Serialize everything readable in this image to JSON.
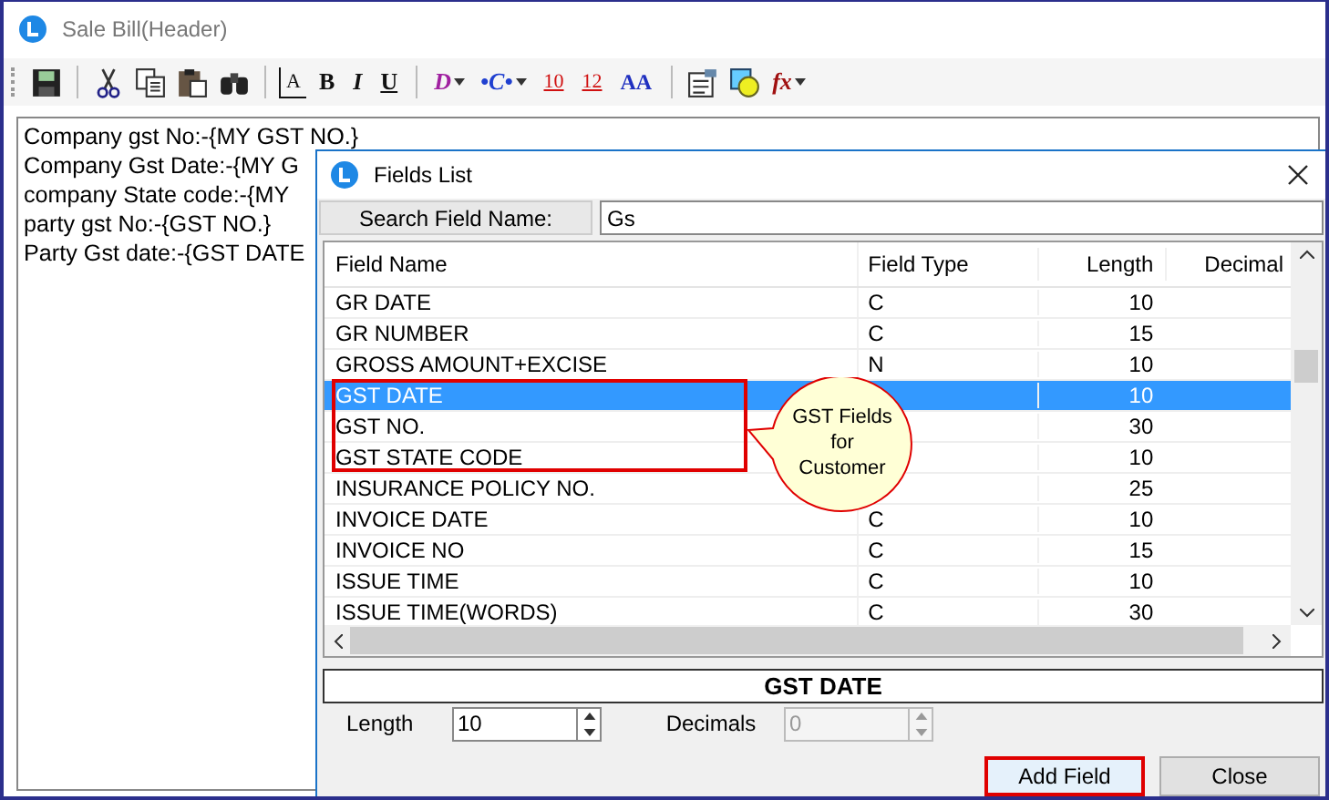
{
  "window": {
    "title": "Sale Bill(Header)"
  },
  "toolbar": [
    {
      "kind": "save"
    },
    {
      "kind": "sep"
    },
    {
      "kind": "cut"
    },
    {
      "kind": "copy"
    },
    {
      "kind": "paste"
    },
    {
      "kind": "find"
    },
    {
      "kind": "sep"
    },
    {
      "kind": "boxed",
      "glyph": "A"
    },
    {
      "kind": "bold",
      "glyph": "B"
    },
    {
      "kind": "italic",
      "glyph": "I"
    },
    {
      "kind": "underline",
      "glyph": "U"
    },
    {
      "kind": "sep"
    },
    {
      "kind": "draw",
      "glyph": "D"
    },
    {
      "kind": "connector",
      "glyph": "•C•"
    },
    {
      "kind": "size",
      "glyph": "10"
    },
    {
      "kind": "size",
      "glyph": "12"
    },
    {
      "kind": "font",
      "glyph": "AA"
    },
    {
      "kind": "sep"
    },
    {
      "kind": "properties"
    },
    {
      "kind": "shapes"
    },
    {
      "kind": "function",
      "glyph": "fx"
    }
  ],
  "editor": {
    "lines": [
      "Company gst No:-{MY GST NO.}",
      "Company Gst Date:-{MY G",
      "company State code:-{MY",
      "party gst No:-{GST NO.}",
      "Party Gst date:-{GST DATE"
    ]
  },
  "dialog": {
    "title": "Fields List",
    "search": {
      "label": "Search Field Name:",
      "value": "Gs"
    },
    "table": {
      "columns": [
        "Field Name",
        "Field Type",
        "Length",
        "Decimal"
      ],
      "rows": [
        {
          "name": "GR DATE",
          "type": "C",
          "length": "10",
          "selected": false,
          "marked": false
        },
        {
          "name": "GR NUMBER",
          "type": "C",
          "length": "15",
          "selected": false,
          "marked": false
        },
        {
          "name": "GROSS AMOUNT+EXCISE",
          "type": "N",
          "length": "10",
          "selected": false,
          "marked": false
        },
        {
          "name": "GST DATE",
          "length": "10",
          "selected": true,
          "marked": true
        },
        {
          "name": "GST NO.",
          "length": "30",
          "selected": false,
          "marked": true
        },
        {
          "name": "GST STATE CODE",
          "length": "10",
          "selected": false,
          "marked": true
        },
        {
          "name": "INSURANCE POLICY NO.",
          "length": "25",
          "selected": false,
          "marked": false
        },
        {
          "name": "INVOICE DATE",
          "type": "C",
          "length": "10",
          "selected": false,
          "marked": false
        },
        {
          "name": "INVOICE NO",
          "type": "C",
          "length": "15",
          "selected": false,
          "marked": false
        },
        {
          "name": "ISSUE TIME",
          "type": "C",
          "length": "10",
          "selected": false,
          "marked": false
        },
        {
          "name": "ISSUE TIME(WORDS)",
          "type": "C",
          "length": "30",
          "selected": false,
          "marked": false
        }
      ]
    },
    "callout": {
      "lines": [
        "GST Fields",
        "for",
        "Customer"
      ]
    },
    "selected_name": "GST DATE",
    "length": {
      "label": "Length",
      "value": "10"
    },
    "decimals": {
      "label": "Decimals",
      "value": "0",
      "disabled": true
    },
    "buttons": [
      {
        "label": "Add Field",
        "highlighted": true
      },
      {
        "label": "Close",
        "highlighted": false
      }
    ]
  }
}
